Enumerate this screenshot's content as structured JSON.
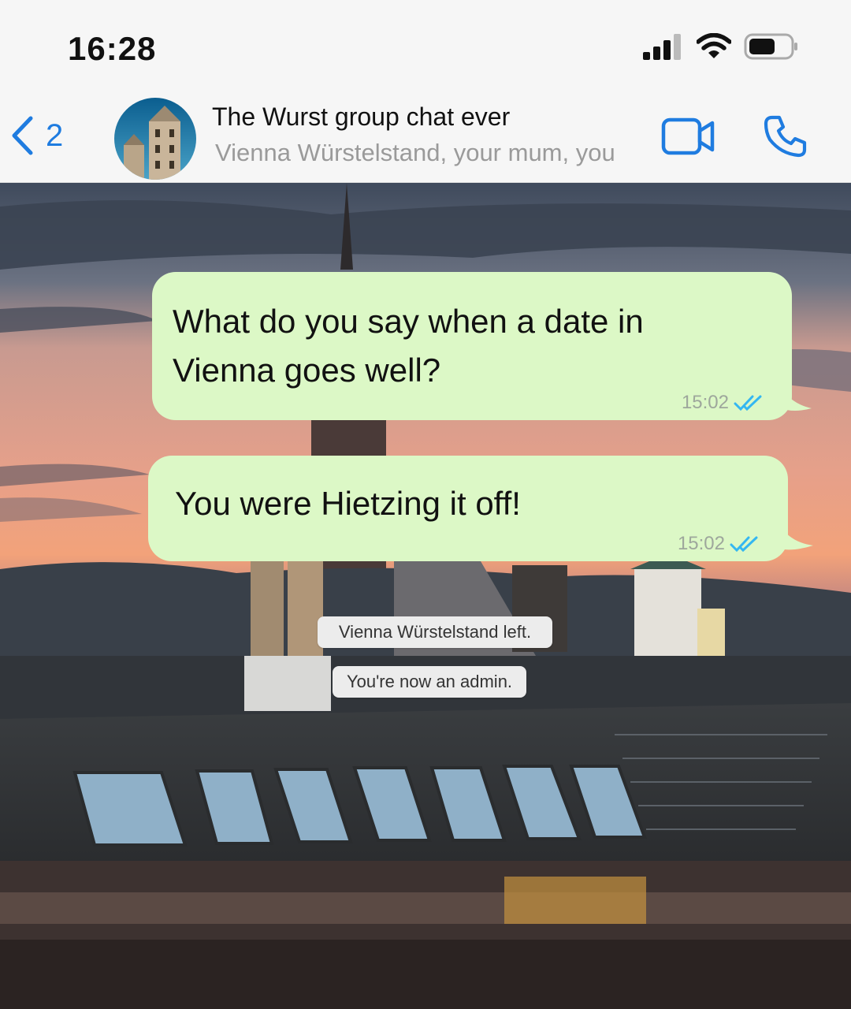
{
  "status_bar": {
    "time": "16:28",
    "icons": [
      "cellular-signal-icon",
      "wifi-icon",
      "battery-icon"
    ]
  },
  "header": {
    "back_count": "2",
    "title": "The Wurst group chat ever",
    "subtitle": "Vienna Würstelstand, your mum, you",
    "icons": [
      "chevron-left-icon",
      "group-avatar",
      "video-call-icon",
      "phone-icon"
    ]
  },
  "messages": [
    {
      "text_lines": [
        "What do you say when a date in",
        "Vienna goes well?"
      ],
      "time": "15:02",
      "status": "read"
    },
    {
      "text_lines": [
        "You were Hietzing it off!"
      ],
      "time": "15:02",
      "status": "read"
    }
  ],
  "system_messages": [
    "Vienna Würstelstand left.",
    "You're now an admin."
  ],
  "colors": {
    "accent": "#1f7ce0",
    "bubble": "#dcf8c6",
    "read_ticks": "#34b7f1"
  }
}
